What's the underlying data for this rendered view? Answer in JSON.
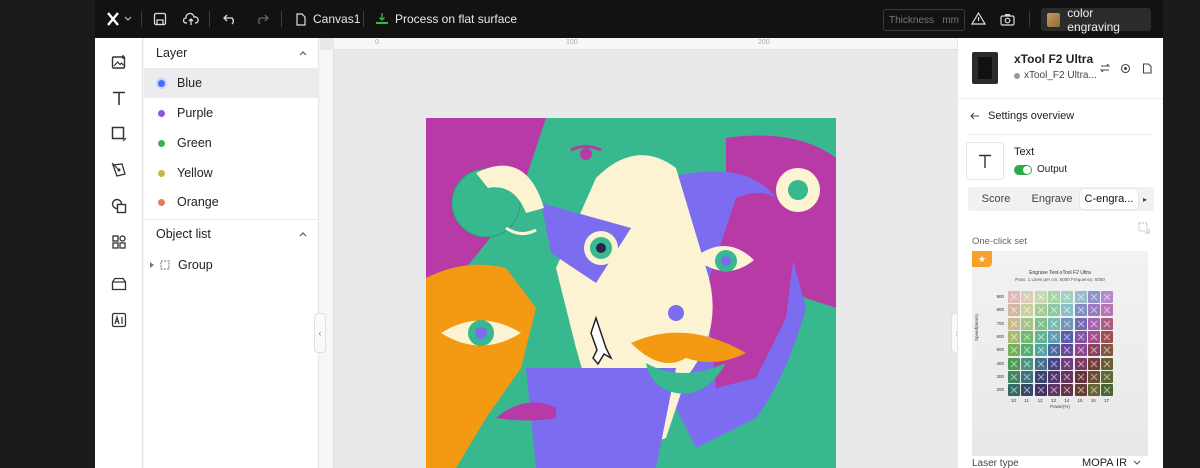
{
  "topbar": {
    "file_name": "Canvas1",
    "process_mode": "Process on flat surface",
    "thickness_placeholder": "Thickness",
    "thickness_unit": "mm",
    "material_label": "color engraving"
  },
  "layer_panel": {
    "title": "Layer",
    "layers": [
      {
        "label": "Blue",
        "color": "#4a6cf7"
      },
      {
        "label": "Purple",
        "color": "#8a55e0"
      },
      {
        "label": "Green",
        "color": "#37b25a"
      },
      {
        "label": "Yellow",
        "color": "#cbb34a"
      },
      {
        "label": "Orange",
        "color": "#e47a5a"
      }
    ],
    "object_list_title": "Object list",
    "objects": [
      {
        "label": "Group"
      }
    ]
  },
  "canvas": {
    "ruler_labels": [
      "0",
      "100",
      "200"
    ]
  },
  "right_panel": {
    "device_name": "xTool F2 Ultra",
    "device_connection": "xTool_F2 Ultra...",
    "settings_title": "Settings overview",
    "item_type": "Text",
    "output_label": "Output",
    "tabs": [
      "Score",
      "Engrave",
      "C-engra..."
    ],
    "one_click_label": "One-click set",
    "laser_type_label": "Laser type",
    "laser_type_value": "MOPA IR",
    "sample": {
      "title": "Engrave Test-xTool F2 Ultra",
      "subtitle": "Pass: 1 Lines per cm: 5000 Frequency: 5000",
      "y_axis": "Speed(mm/s)",
      "x_axis": "Power(%)",
      "rows": [
        "900",
        "800",
        "700",
        "600",
        "500",
        "400",
        "300",
        "200"
      ],
      "cols": [
        "10",
        "11",
        "12",
        "13",
        "14",
        "15",
        "16",
        "17"
      ]
    }
  },
  "colors": {
    "art_magenta": "#b83aa6",
    "art_green": "#38b88e",
    "art_cream": "#fbf3d2",
    "art_purple": "#7b6cf0",
    "art_orange": "#f39a12",
    "art_dark": "#2a2250",
    "accent_green": "#2eaa4a"
  }
}
